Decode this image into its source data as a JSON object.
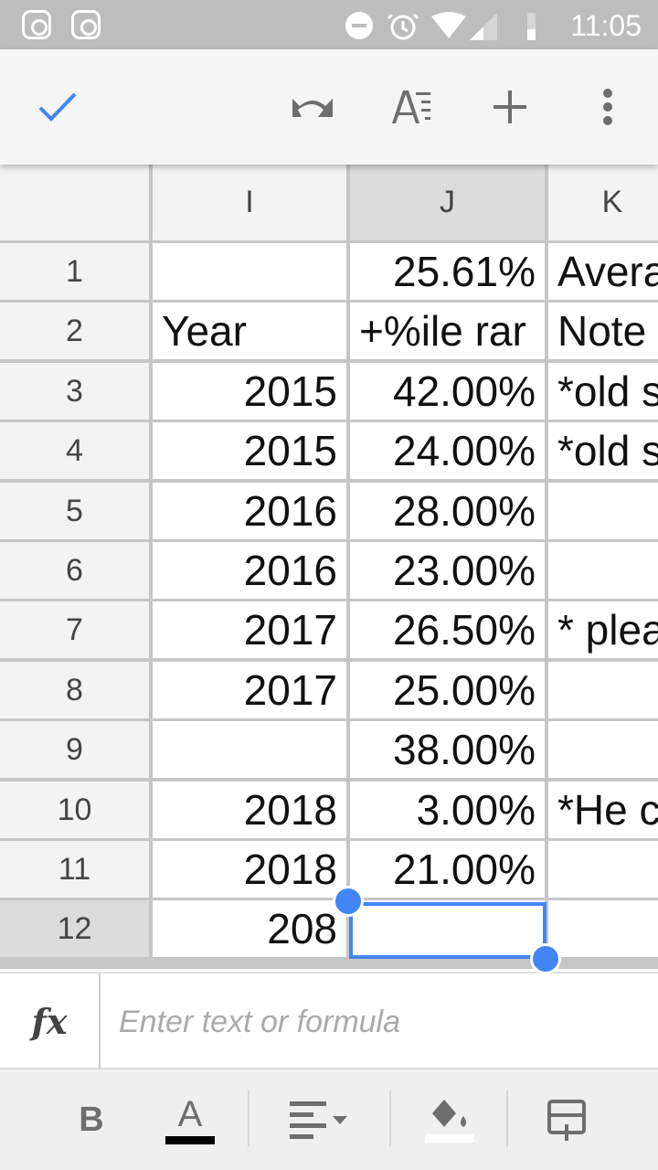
{
  "status_bar": {
    "time": "11:05",
    "left_icons": [
      "instagram-icon",
      "instagram-icon"
    ],
    "right_icons": [
      "dnd-icon",
      "alarm-icon",
      "wifi-icon",
      "signal-icon",
      "battery-icon"
    ]
  },
  "app_bar": {
    "icons": [
      "check-icon",
      "redo-icon",
      "text-format-icon",
      "plus-icon",
      "more-vert-icon"
    ],
    "accent": "#4285f4"
  },
  "columns": [
    "I",
    "J",
    "K"
  ],
  "selected_column": "J",
  "selected_row": "12",
  "rows": [
    {
      "n": "1",
      "I": "",
      "J": "25.61%",
      "K": "Avera"
    },
    {
      "n": "2",
      "I": "Year",
      "J": "+%ile rar",
      "K": "Note"
    },
    {
      "n": "3",
      "I": "2015",
      "J": "42.00%",
      "K": "*old s"
    },
    {
      "n": "4",
      "I": "2015",
      "J": "24.00%",
      "K": "*old s"
    },
    {
      "n": "5",
      "I": "2016",
      "J": "28.00%",
      "K": ""
    },
    {
      "n": "6",
      "I": "2016",
      "J": "23.00%",
      "K": ""
    },
    {
      "n": "7",
      "I": "2017",
      "J": "26.50%",
      "K": "* plea"
    },
    {
      "n": "8",
      "I": "2017",
      "J": "25.00%",
      "K": ""
    },
    {
      "n": "9",
      "I": "",
      "J": "38.00%",
      "K": ""
    },
    {
      "n": "10",
      "I": "2018",
      "J": "3.00%",
      "K": "*He c"
    },
    {
      "n": "11",
      "I": "2018",
      "J": "21.00%",
      "K": ""
    },
    {
      "n": "12",
      "I": "208",
      "J": "",
      "K": ""
    }
  ],
  "formula_bar": {
    "label": "fx",
    "placeholder": "Enter text or formula",
    "value": ""
  },
  "format_bar": {
    "bold": "B",
    "text_color_label": "A",
    "text_color": "#000000",
    "fill_color": "#ffffff",
    "icons": [
      "bold-icon",
      "text-color-icon",
      "align-icon",
      "fill-color-icon",
      "insert-cell-icon"
    ]
  }
}
